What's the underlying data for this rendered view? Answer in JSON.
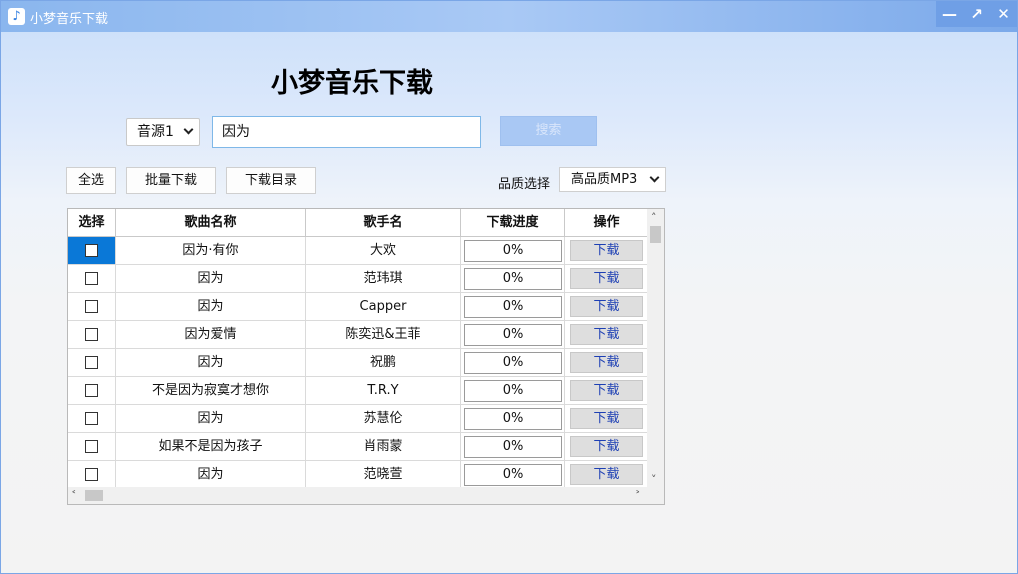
{
  "window": {
    "title": "小梦音乐下载",
    "icon": "music-note-icon"
  },
  "app_title": "小梦音乐下载",
  "source_select": {
    "value": "音源1"
  },
  "search": {
    "value": "因为",
    "button_label": "搜索"
  },
  "toolbar": {
    "select_all": "全选",
    "batch_download": "批量下载",
    "download_dir": "下载目录"
  },
  "quality": {
    "label": "品质选择",
    "value": "高品质MP3"
  },
  "table": {
    "headers": [
      "选择",
      "歌曲名称",
      "歌手名",
      "下载进度",
      "操作"
    ],
    "rows": [
      {
        "song": "因为·有你",
        "singer": "大欢",
        "progress": "0%",
        "action": "下载"
      },
      {
        "song": "因为",
        "singer": "范玮琪",
        "progress": "0%",
        "action": "下载"
      },
      {
        "song": "因为",
        "singer": "Capper",
        "progress": "0%",
        "action": "下载"
      },
      {
        "song": "因为爱情",
        "singer": "陈奕迅&王菲",
        "progress": "0%",
        "action": "下载"
      },
      {
        "song": "因为",
        "singer": "祝鹏",
        "progress": "0%",
        "action": "下载"
      },
      {
        "song": "不是因为寂寞才想你",
        "singer": "T.R.Y",
        "progress": "0%",
        "action": "下载"
      },
      {
        "song": "因为",
        "singer": "苏慧伦",
        "progress": "0%",
        "action": "下载"
      },
      {
        "song": "如果不是因为孩子",
        "singer": "肖雨蒙",
        "progress": "0%",
        "action": "下载"
      },
      {
        "song": "因为",
        "singer": "范晓萱",
        "progress": "0%",
        "action": "下载"
      }
    ]
  }
}
